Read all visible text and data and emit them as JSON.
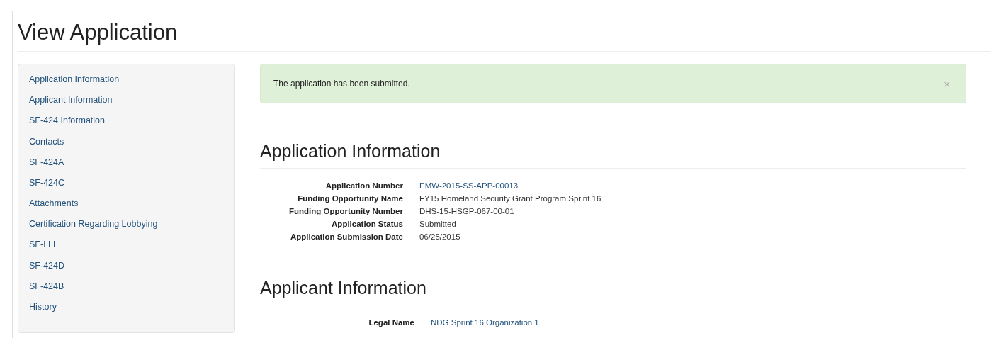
{
  "page_title": "View Application",
  "sidebar": {
    "items": [
      {
        "label": "Application Information"
      },
      {
        "label": "Applicant Information"
      },
      {
        "label": "SF-424 Information"
      },
      {
        "label": "Contacts"
      },
      {
        "label": "SF-424A"
      },
      {
        "label": "SF-424C"
      },
      {
        "label": "Attachments"
      },
      {
        "label": "Certification Regarding Lobbying"
      },
      {
        "label": "SF-LLL"
      },
      {
        "label": "SF-424D"
      },
      {
        "label": "SF-424B"
      },
      {
        "label": "History"
      }
    ]
  },
  "alert": {
    "message": "The application has been submitted.",
    "close": "×"
  },
  "sections": [
    {
      "heading": "Application Information",
      "fields": [
        {
          "label": "Application Number",
          "value": "EMW-2015-SS-APP-00013",
          "kind": "link"
        },
        {
          "label": "Funding Opportunity Name",
          "value": "FY15 Homeland Security Grant Program Sprint 16",
          "kind": "text"
        },
        {
          "label": "Funding Opportunity Number",
          "value": "DHS-15-HSGP-067-00-01",
          "kind": "text"
        },
        {
          "label": "Application Status",
          "value": "Submitted",
          "kind": "text"
        },
        {
          "label": "Application Submission Date",
          "value": "06/25/2015",
          "kind": "text"
        }
      ]
    },
    {
      "heading": "Applicant Information",
      "fields": [
        {
          "label": "Legal Name",
          "value": "NDG Sprint 16 Organization 1",
          "kind": "link"
        }
      ]
    }
  ]
}
